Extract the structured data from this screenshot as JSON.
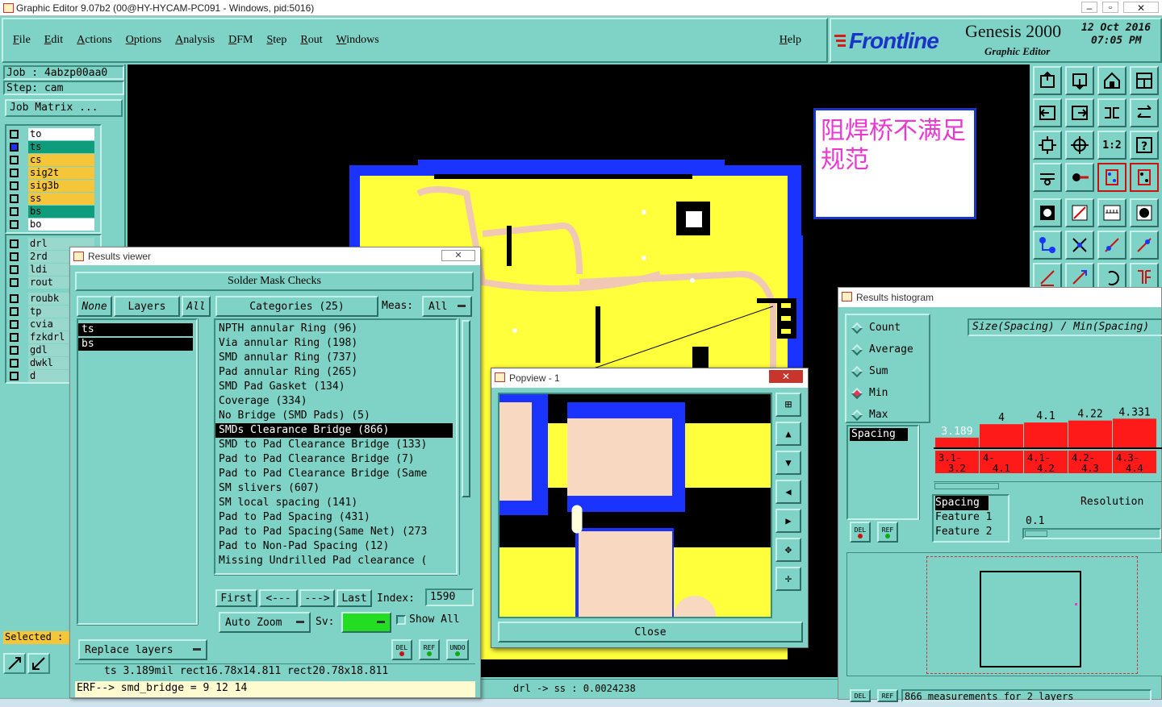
{
  "window": {
    "title": "Graphic Editor 9.07b2 (00@HY-HYCAM-PC091 - Windows, pid:5016)"
  },
  "menu": {
    "items": [
      "File",
      "Edit",
      "Actions",
      "Options",
      "Analysis",
      "DFM",
      "Step",
      "Rout",
      "Windows"
    ],
    "help": "Help"
  },
  "brand": {
    "logo": "Frontline",
    "product": "Genesis 2000",
    "subtitle": "Graphic Editor",
    "date": "12 Oct 2016",
    "time": "07:05 PM"
  },
  "job": {
    "job": "Job : 4abzp00aa0",
    "step": "Step: cam",
    "matrix": "Job Matrix ..."
  },
  "layers": [
    {
      "name": "to",
      "color": "#ffffff"
    },
    {
      "name": "ts",
      "color": "#0e9c7c"
    },
    {
      "name": "cs",
      "color": "#f5c63a"
    },
    {
      "name": "sig2t",
      "color": "#f5c63a"
    },
    {
      "name": "sig3b",
      "color": "#f5c63a"
    },
    {
      "name": "ss",
      "color": "#f5c63a"
    },
    {
      "name": "bs",
      "color": "#0e9c7c"
    },
    {
      "name": "bo",
      "color": "#ffffff"
    }
  ],
  "layers2": [
    "drl",
    "2rd",
    "ldi",
    "rout",
    "roubk",
    "tp",
    "cvia",
    "fzkdrl",
    "gdl",
    "dwkl",
    "d"
  ],
  "selected": "Selected :",
  "note": {
    "text": "阻焊桥不满足规范"
  },
  "results_viewer": {
    "title": "Results viewer",
    "heading": "Solder Mask Checks",
    "none_btn": "None",
    "layers_btn": "Layers",
    "all_btn": "All",
    "categories_btn": "Categories (25)",
    "meas_label": "Meas:",
    "meas_value": "All",
    "layer_items": [
      "ts",
      "bs"
    ],
    "categories": [
      "NPTH annular Ring (96)",
      "Via annular Ring (198)",
      "SMD annular Ring (737)",
      "Pad annular Ring (265)",
      "SMD Pad Gasket (134)",
      "Coverage (334)",
      "No Bridge (SMD Pads) (5)",
      "SMDs Clearance Bridge (866)",
      "SMD to Pad Clearance Bridge (133)",
      "Pad to Pad Clearance Bridge (7)",
      "Pad to Pad Clearance Bridge (Same",
      "SM slivers (607)",
      "SM local spacing (141)",
      "Pad to Pad Spacing (431)",
      "Pad to Pad Spacing(Same Net) (273",
      "Pad to Non-Pad Spacing (12)",
      "Missing Undrilled Pad clearance ("
    ],
    "selected_index": 7,
    "first": "First",
    "prev": "<---",
    "next": "--->",
    "last": "Last",
    "index_label": "Index:",
    "index_value": "1590",
    "auto_zoom": "Auto Zoom",
    "sv_label": "Sv:",
    "show_all": "Show All",
    "replace_layers": "Replace layers",
    "del": "DEL",
    "ref": "REF",
    "undo": "UNDO",
    "status": "ts 3.189mil  rect16.78x14.811  rect20.78x18.811",
    "erf": "ERF--> smd_bridge = 9 12 14"
  },
  "popview": {
    "title": "Popview - 1",
    "close": "Close"
  },
  "bottom_status": "drl -> ss : 0.0024238",
  "histogram": {
    "title": "Results histogram",
    "modes": [
      "Count",
      "Average",
      "Sum",
      "Min",
      "Max"
    ],
    "selected_mode": "Min",
    "metric_item": "Spacing",
    "axis_label": "Size(Spacing) / Min(Spacing)",
    "del": "DEL",
    "ref": "REF",
    "info": [
      "Spacing",
      "Feature 1",
      "Feature 2"
    ],
    "resolution_label": "Resolution",
    "resolution_value": "0.1",
    "footer": "866 measurements for 2 layers"
  },
  "chart_data": {
    "type": "bar",
    "categories": [
      "3.1-3.2",
      "4-4.1",
      "4.1-4.2",
      "4.2-4.3",
      "4.3-4.4"
    ],
    "values": [
      3.189,
      4,
      4.1,
      4.22,
      4.331
    ],
    "title": "Size(Spacing) / Min(Spacing)",
    "xlabel": "",
    "ylabel": "",
    "colors": {
      "bar": "#ff1a1a",
      "label": "#000000",
      "highlight": "#ff1a1a"
    }
  }
}
